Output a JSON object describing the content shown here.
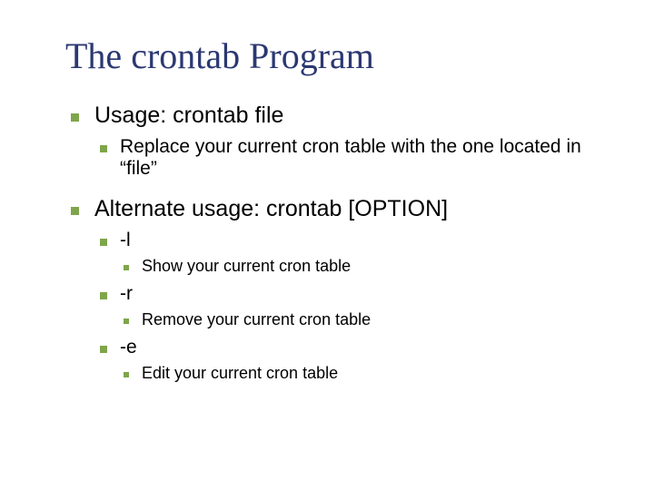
{
  "title": "The crontab Program",
  "points": [
    {
      "text": "Usage: crontab file",
      "children": [
        {
          "text": "Replace your current cron table with the one located in “file”"
        }
      ]
    },
    {
      "text": "Alternate usage: crontab [OPTION]",
      "options": [
        {
          "flag": "-l",
          "desc": "Show your current cron table"
        },
        {
          "flag": "-r",
          "desc": "Remove your current cron table"
        },
        {
          "flag": "-e",
          "desc": "Edit your current cron table"
        }
      ]
    }
  ]
}
